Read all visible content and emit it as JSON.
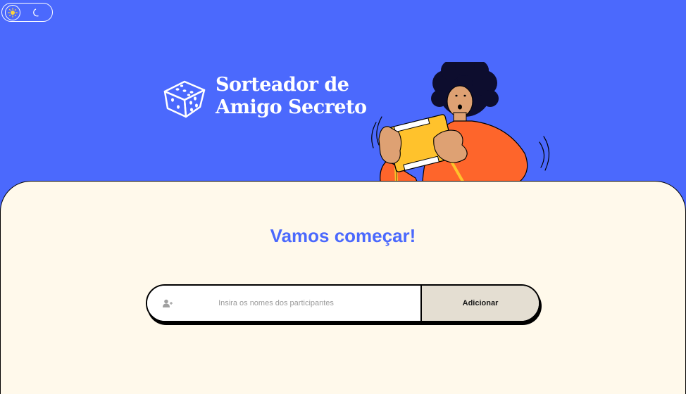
{
  "theme_toggle": {
    "light_icon": "sun-icon",
    "dark_icon": "moon-icon"
  },
  "logo": {
    "icon": "dice-icon",
    "line1": "Sorteador de",
    "line2": "Amigo Secreto"
  },
  "illustration": {
    "name": "person-opening-gift-illustration"
  },
  "main": {
    "title": "Vamos começar!"
  },
  "form": {
    "input_icon": "add-user-icon",
    "input_placeholder": "Insira os nomes dos participantes",
    "input_value": "",
    "add_button_label": "Adicionar"
  },
  "colors": {
    "primary": "#4b69fd",
    "background": "#fff9eb",
    "button": "#e4ded2",
    "accent_orange": "#fe652b",
    "accent_yellow": "#ffc22c"
  }
}
